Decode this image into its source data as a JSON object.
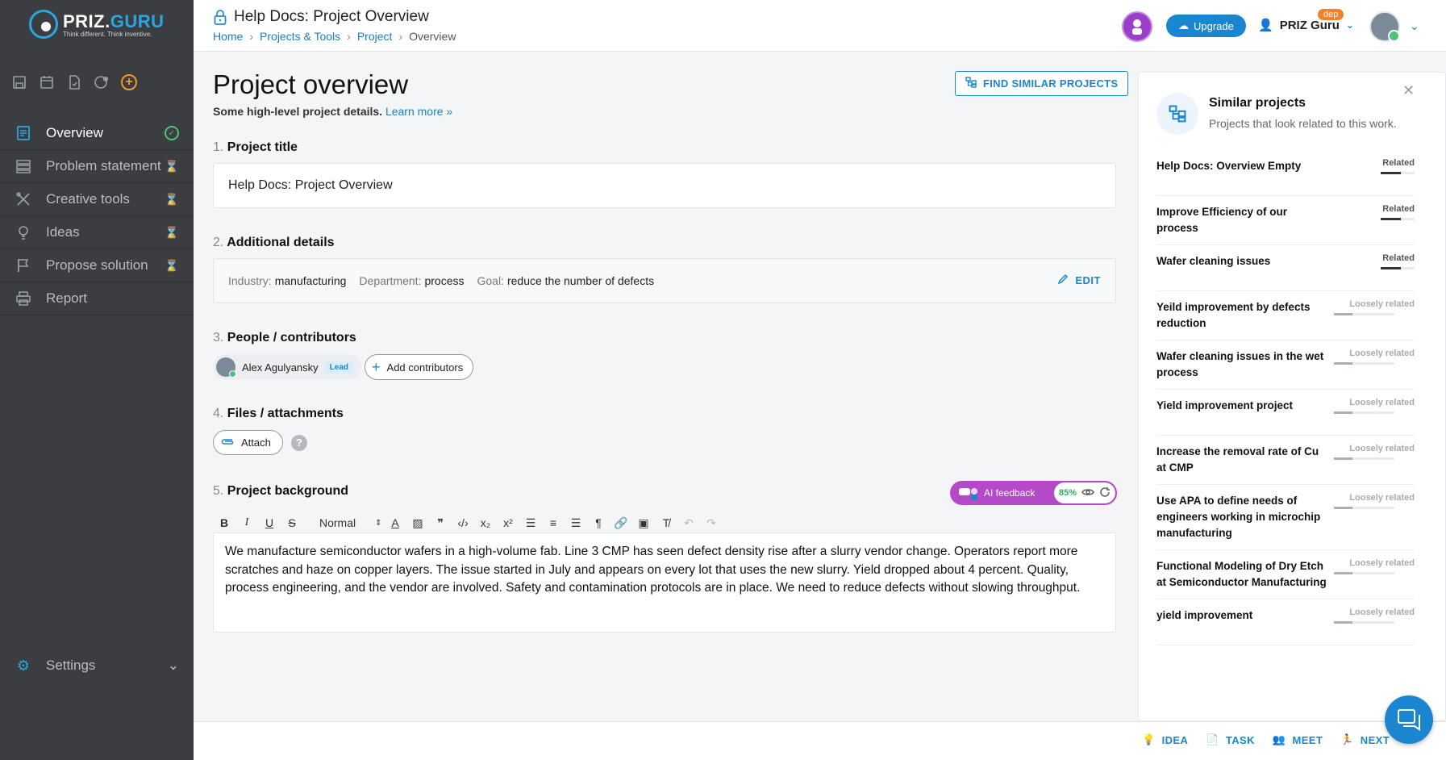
{
  "app": {
    "logo_name_a": "PRIZ.",
    "logo_name_b": "GURU",
    "logo_tagline": "Think different. Think inventive."
  },
  "sidebar": {
    "nav": [
      {
        "label": "Overview",
        "icon": "document-icon",
        "status": "complete"
      },
      {
        "label": "Problem statement",
        "icon": "layers-icon",
        "status": "pending"
      },
      {
        "label": "Creative tools",
        "icon": "tools-icon",
        "status": "pending"
      },
      {
        "label": "Ideas",
        "icon": "lightbulb-icon",
        "status": "pending"
      },
      {
        "label": "Propose solution",
        "icon": "flag-icon",
        "status": "pending"
      },
      {
        "label": "Report",
        "icon": "printer-icon",
        "status": "none"
      }
    ],
    "settings_label": "Settings"
  },
  "header": {
    "title": "Help Docs: Project Overview",
    "breadcrumbs": [
      "Home",
      "Projects & Tools",
      "Project",
      "Overview"
    ],
    "upgrade_label": "Upgrade",
    "org_name": "PRIZ Guru",
    "org_badge": "dep"
  },
  "main": {
    "title": "Project overview",
    "subtitle": "Some high-level project details.",
    "learn_more": "Learn more »",
    "find_similar": "FIND SIMILAR PROJECTS",
    "sections": {
      "s1": {
        "num": "1.",
        "label": "Project title"
      },
      "s2": {
        "num": "2.",
        "label": "Additional details"
      },
      "s3": {
        "num": "3.",
        "label": "People / contributors"
      },
      "s4": {
        "num": "4.",
        "label": "Files / attachments"
      },
      "s5": {
        "num": "5.",
        "label": "Project background"
      }
    },
    "project_title_value": "Help Docs: Project Overview",
    "details": {
      "industry_k": "Industry:",
      "industry_v": "manufacturing",
      "department_k": "Department:",
      "department_v": "process",
      "goal_k": "Goal:",
      "goal_v": "reduce the number of defects",
      "edit_label": "EDIT"
    },
    "contributors": {
      "person_name": "Alex Agulyansky",
      "person_role": "Lead",
      "add_label": "Add contributors"
    },
    "attach_label": "Attach",
    "help_glyph": "?",
    "ai_feedback": {
      "label": "AI feedback",
      "score": "85%"
    },
    "editor_toolbar": {
      "format": "Normal"
    },
    "background_text": "We manufacture semiconductor wafers in a high-volume fab. Line 3 CMP has seen defect density rise after a slurry vendor change. Operators report more scratches and haze on copper layers. The issue started in July and appears on every lot that uses the new slurry. Yield dropped about 4 percent. Quality, process engineering, and the vendor are involved. Safety and contamination protocols are in place. We need to reduce defects without slowing throughput."
  },
  "similar_panel": {
    "title": "Similar projects",
    "subtitle": "Projects that look related to this work.",
    "items": [
      {
        "name": "Help Docs: Overview Empty",
        "relation": "Related",
        "strength": 0.6
      },
      {
        "name": "Improve Efficiency of our process",
        "relation": "Related",
        "strength": 0.6
      },
      {
        "name": "Wafer cleaning issues",
        "relation": "Related",
        "strength": 0.6
      },
      {
        "name": "Yeild improvement by defects reduction",
        "relation": "Loosely related",
        "strength": 0.3
      },
      {
        "name": "Wafer cleaning issues in the wet process",
        "relation": "Loosely related",
        "strength": 0.3
      },
      {
        "name": "Yield improvement project",
        "relation": "Loosely related",
        "strength": 0.3
      },
      {
        "name": "Increase the removal rate of Cu at CMP",
        "relation": "Loosely related",
        "strength": 0.3
      },
      {
        "name": "Use APA to define needs of engineers working in microchip manufacturing",
        "relation": "Loosely related",
        "strength": 0.3
      },
      {
        "name": "Functional Modeling of Dry Etch at Semiconductor Manufacturing",
        "relation": "Loosely related",
        "strength": 0.3
      },
      {
        "name": "yield improvement",
        "relation": "Loosely related",
        "strength": 0.3
      }
    ]
  },
  "footer": {
    "idea": "IDEA",
    "task": "TASK",
    "meet": "MEET",
    "next": "NEXT"
  },
  "colors": {
    "accent": "#1a86d0",
    "sidebar_bg": "#3b3d40",
    "ai_feedback": "#b44ac8",
    "success": "#4cc27a",
    "badge": "#f0822a"
  }
}
